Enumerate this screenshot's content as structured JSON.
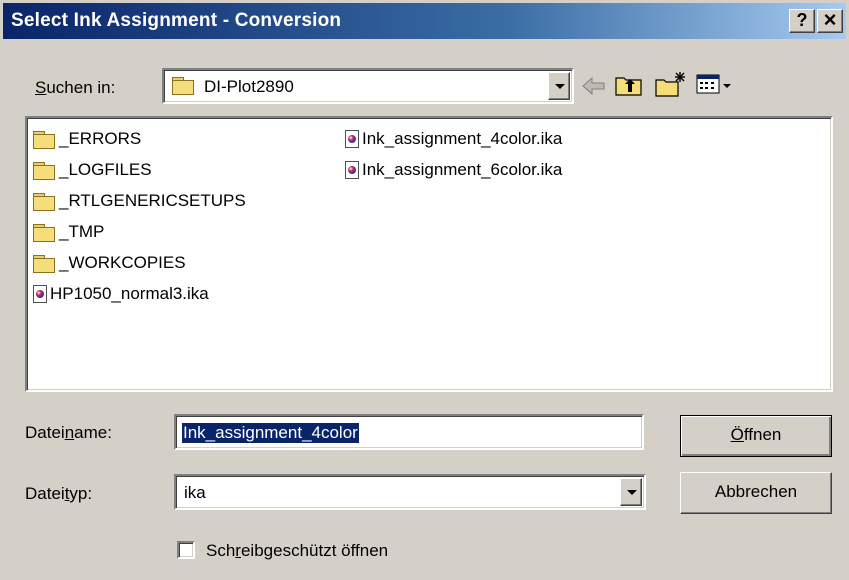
{
  "window": {
    "title": "Select Ink Assignment - Conversion",
    "help_button": "?",
    "close_button": "×"
  },
  "look_in": {
    "label": "Suchen in:",
    "value": "DI-Plot2890"
  },
  "files": {
    "column1": [
      {
        "name": "_ERRORS",
        "type": "folder"
      },
      {
        "name": "_LOGFILES",
        "type": "folder"
      },
      {
        "name": "_RTLGENERICSETUPS",
        "type": "folder"
      },
      {
        "name": "_TMP",
        "type": "folder"
      },
      {
        "name": "_WORKCOPIES",
        "type": "folder"
      },
      {
        "name": "HP1050_normal3.ika",
        "type": "file"
      }
    ],
    "column2": [
      {
        "name": "Ink_assignment_4color.ika",
        "type": "file"
      },
      {
        "name": "Ink_assignment_6color.ika",
        "type": "file"
      }
    ]
  },
  "filename": {
    "label": "Dateiname:",
    "value": "Ink_assignment_4color"
  },
  "filetype": {
    "label": "Dateityp:",
    "value": "ika"
  },
  "buttons": {
    "open": "Öffnen",
    "cancel": "Abbrechen"
  },
  "readonly": {
    "label": "Schreibgeschützt öffnen",
    "checked": false
  },
  "colors": {
    "titlebar_start": "#0a246a",
    "titlebar_end": "#a6caf0",
    "face": "#d4d0c8",
    "selection": "#0a246a"
  }
}
